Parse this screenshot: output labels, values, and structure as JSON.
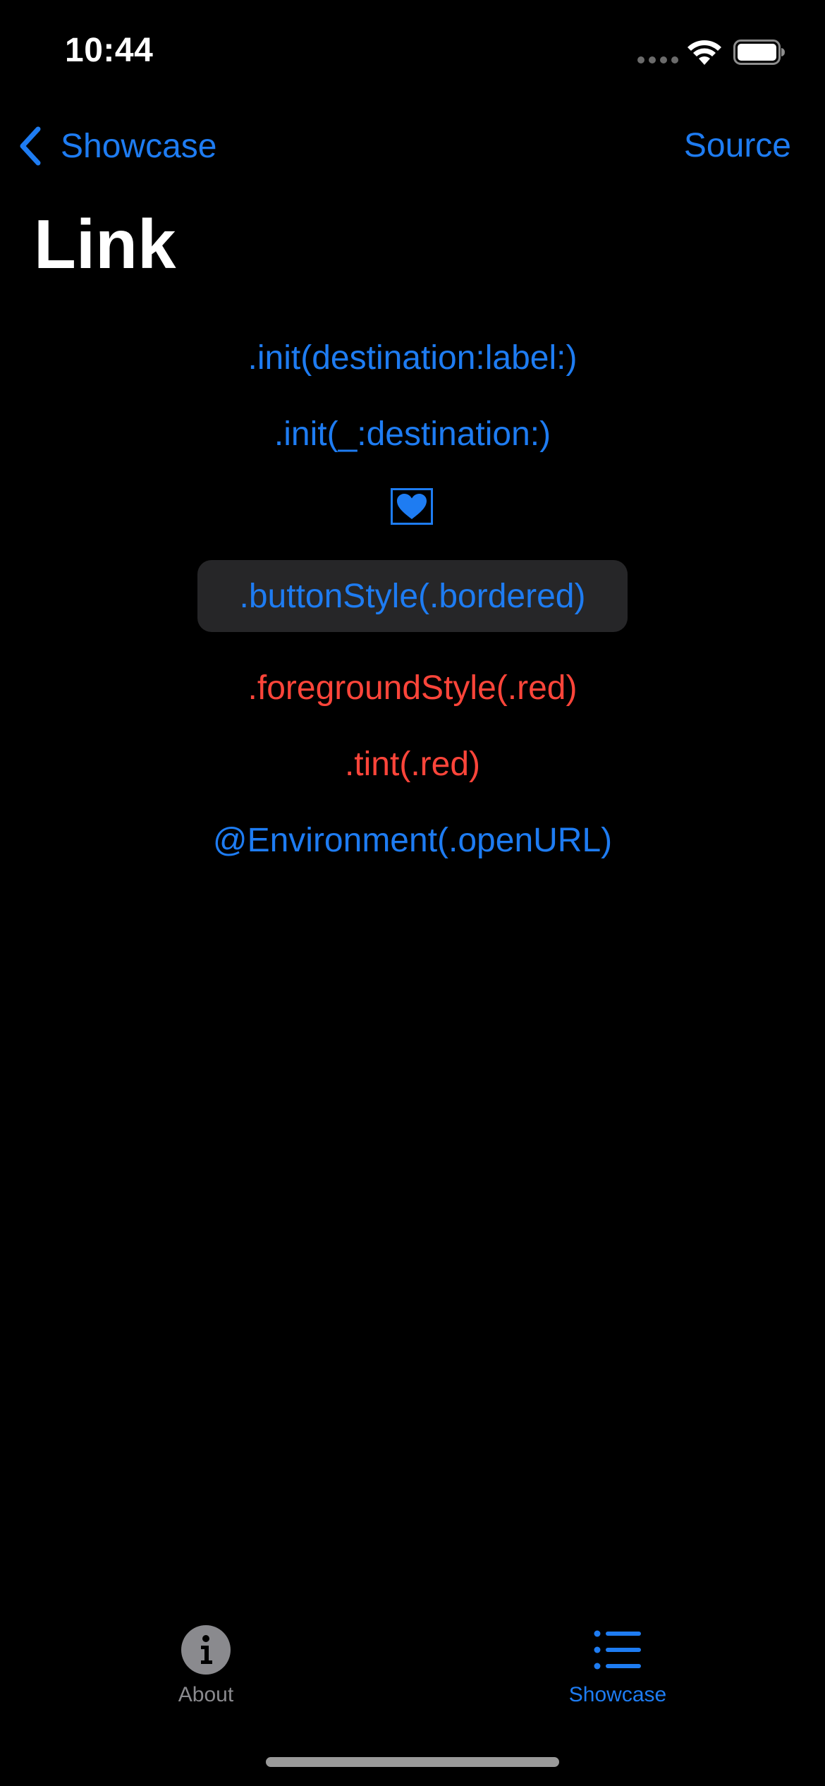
{
  "status_bar": {
    "time": "10:44",
    "icons": [
      "signal-dots-icon",
      "wifi-icon",
      "battery-icon"
    ]
  },
  "nav": {
    "back_label": "Showcase",
    "right_label": "Source",
    "title": "Link"
  },
  "links": {
    "init_destination_label": ".init(destination:label:)",
    "init_title_destination": ".init(_:destination:)",
    "heart_icon": "heart-icon",
    "button_style_bordered": ".buttonStyle(.bordered)",
    "foreground_style_red": ".foregroundStyle(.red)",
    "tint_red": ".tint(.red)",
    "environment_open_url": "@Environment(.openURL)"
  },
  "tab_bar": {
    "about_label": "About",
    "showcase_label": "Showcase",
    "selected": "Showcase"
  },
  "colors": {
    "background": "#000000",
    "accent": "#1e7cf2",
    "red": "#ff453a",
    "button_fill": "#262628",
    "inactive": "#8a8a8e"
  }
}
